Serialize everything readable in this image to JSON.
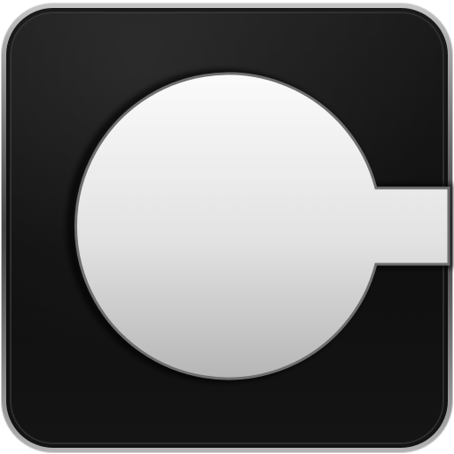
{
  "app_icon": {
    "icon_name": "circle-with-slot-logo-icon",
    "colors": {
      "tile_base": "#111111",
      "tile_edge_highlight": "#bdbdbd",
      "disc_top": "#fafafa",
      "disc_bottom": "#b8b8b8",
      "disc_outline": "#6f6f6f"
    }
  }
}
